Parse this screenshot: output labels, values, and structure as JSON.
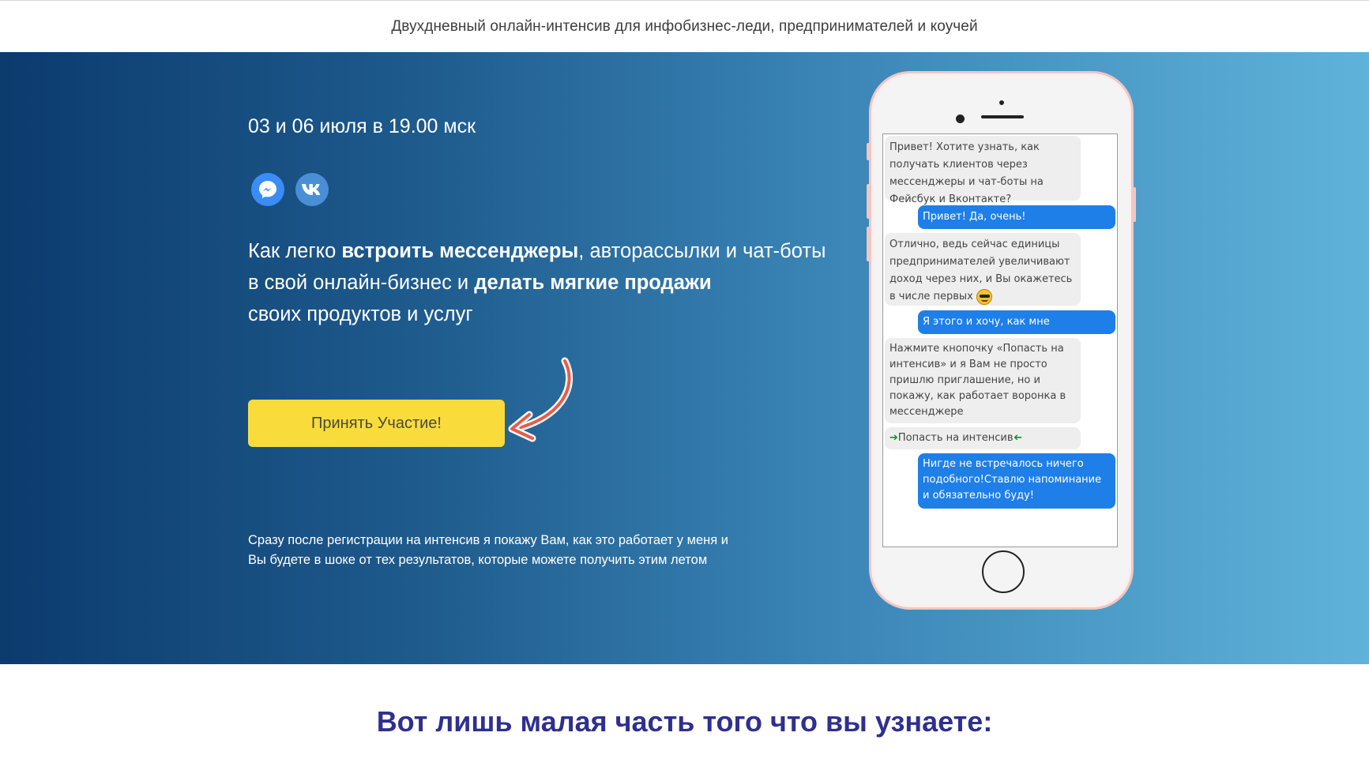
{
  "topbar": {
    "tagline": "Двухдневный онлайн-интенсив для инфобизнес-леди, предпринимателей и коучей"
  },
  "hero": {
    "date": "03 и 06 июля в 19.00 мск",
    "icons": [
      "messenger-icon",
      "vk-icon"
    ],
    "headline": {
      "p1": "Как легко ",
      "b1": "встроить мессенджеры",
      "p2": ", авторассылки и чат-боты",
      "p3": "в свой онлайн-бизнес и ",
      "b2": "делать мягкие продажи",
      "p4": "своих продуктов и услуг"
    },
    "cta_label": "Принять Участие!",
    "note_line1": "Сразу после регистрации на интенсив я покажу Вам, как это работает у меня и",
    "note_line2": "Вы будете в шоке от тех результатов, которые можете получить этим летом"
  },
  "chat": {
    "messages": [
      {
        "from": "bot",
        "text": "Привет! Хотите узнать, как получать клиентов через мессенджеры и чат-боты на Фейсбук и Вконтакте?"
      },
      {
        "from": "user",
        "text": "Привет! Да, очень!"
      },
      {
        "from": "bot",
        "text": "Отлично, ведь сейчас единицы предпринимателей увеличивают доход через них, и Вы окажетесь в числе первых"
      },
      {
        "from": "user",
        "text": "Я этого и хочу, как мне вписаться?"
      },
      {
        "from": "bot",
        "text": "Нажмите кнопочку «Попасть на интенсив» и я Вам не просто пришлю приглашение, но и покажу, как работает воронка в мессенджере"
      },
      {
        "from": "bot",
        "text": "Попасть на интенсив"
      },
      {
        "from": "user",
        "text": "Нигде не встречалось ничего подобного!Ставлю напоминание и обязательно буду!"
      }
    ]
  },
  "section": {
    "title": "Вот лишь малая часть того что вы узнаете:"
  },
  "colors": {
    "gradient_start": "#0c3b6e",
    "gradient_end": "#5fb3da",
    "cta": "#f9dc3c",
    "bubble_user": "#1e7fe8",
    "bubble_bot": "#eeeeee",
    "section_title": "#2f2f8f"
  }
}
